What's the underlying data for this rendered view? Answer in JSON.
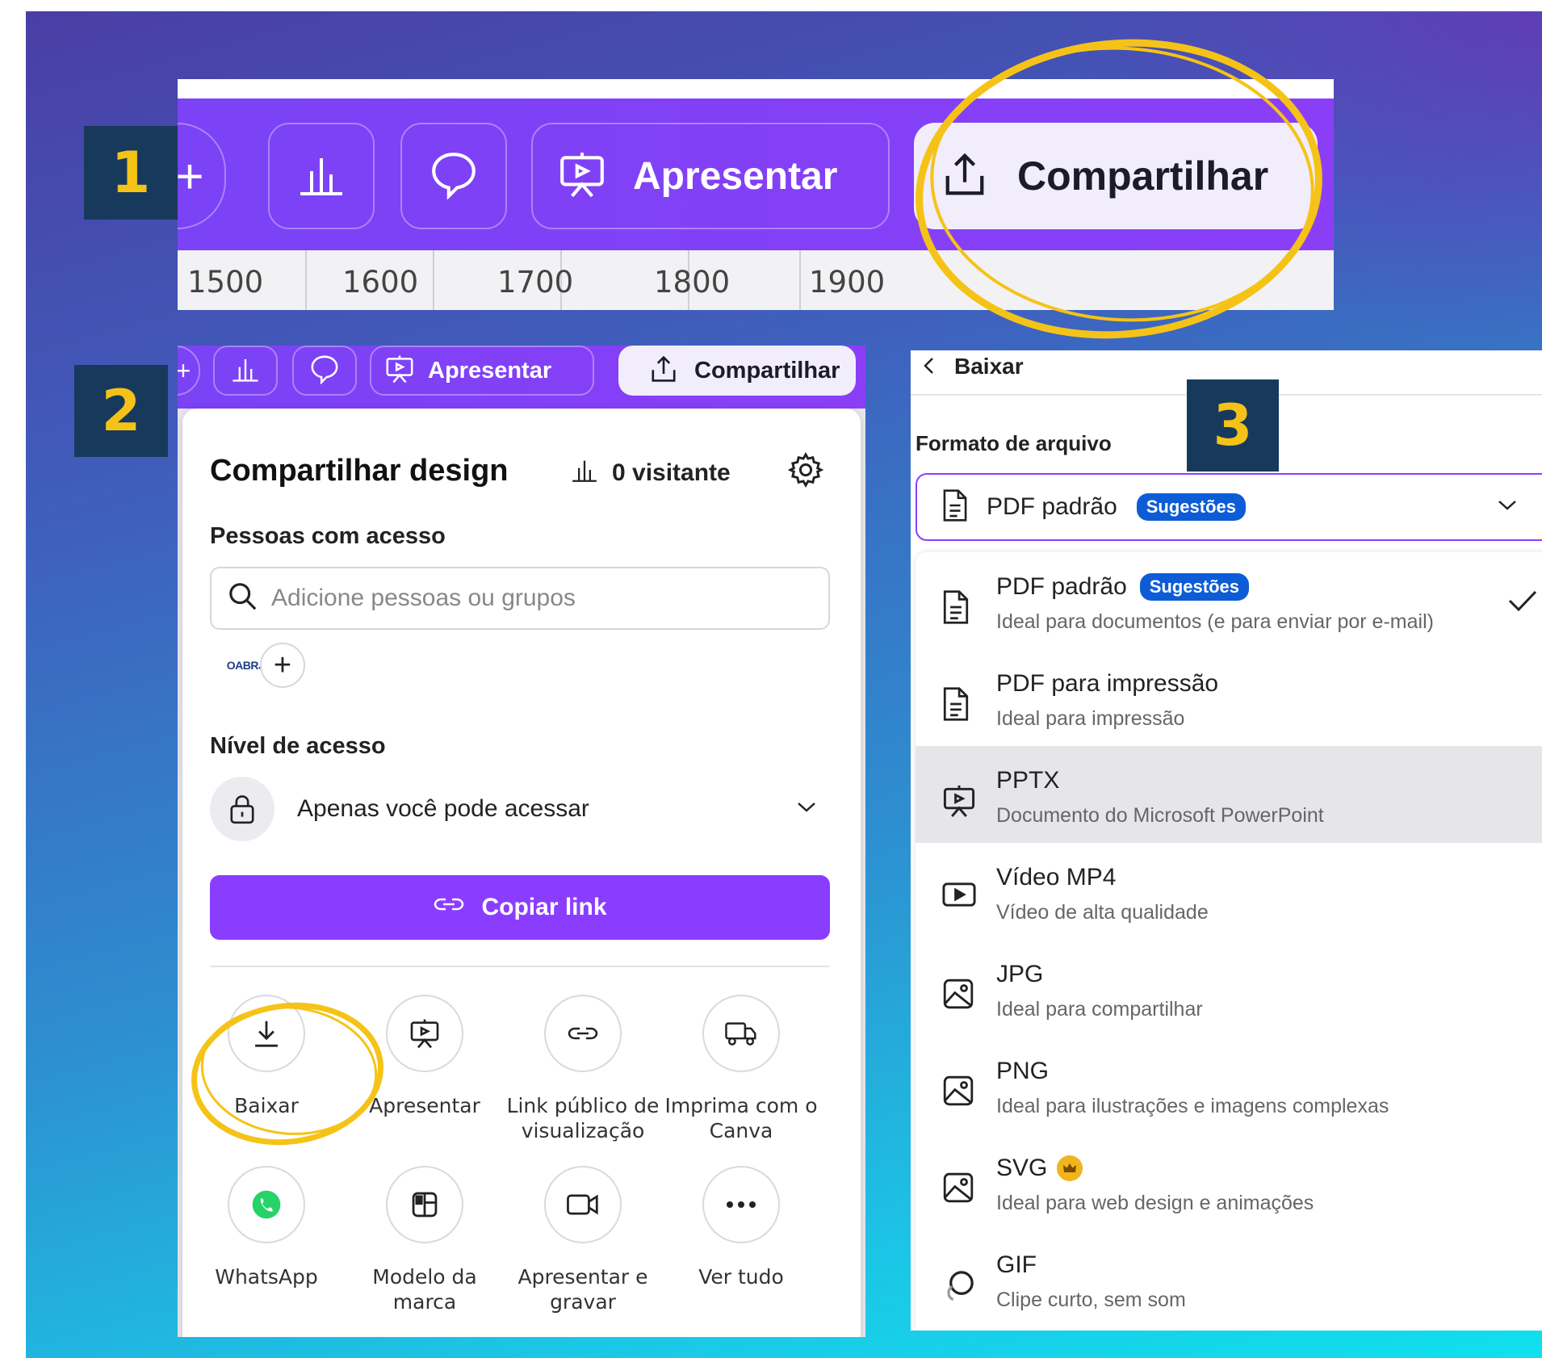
{
  "steps": [
    "1",
    "2",
    "3"
  ],
  "toolbar_large": {
    "plus_label": "+",
    "present_label": "Apresentar",
    "share_label": "Compartilhar",
    "ruler": [
      "1500",
      "1600",
      "1700",
      "1800",
      "1900"
    ]
  },
  "toolbar_small": {
    "plus_label": "+",
    "present_label": "Apresentar",
    "share_label": "Compartilhar"
  },
  "share_panel": {
    "title": "Compartilhar design",
    "visitors": "0 visitante",
    "people_label": "Pessoas com acesso",
    "search_placeholder": "Adicione pessoas ou grupos",
    "avatar_text": "OABRJ",
    "add_person": "+",
    "access_label": "Nível de acesso",
    "access_value": "Apenas você pode acessar",
    "copy_link": "Copiar link",
    "options": [
      {
        "label": "Baixar",
        "icon": "download-icon"
      },
      {
        "label": "Apresentar",
        "icon": "presentation-icon"
      },
      {
        "label": "Link público de visualização",
        "icon": "link-icon"
      },
      {
        "label": "Imprima com o Canva",
        "icon": "truck-icon"
      },
      {
        "label": "WhatsApp",
        "icon": "whatsapp-icon"
      },
      {
        "label": "Modelo da marca",
        "icon": "brand-template-icon"
      },
      {
        "label": "Apresentar e gravar",
        "icon": "video-camera-icon"
      },
      {
        "label": "Ver tudo",
        "icon": "more-icon"
      }
    ]
  },
  "download_panel": {
    "back_label": "Baixar",
    "format_label": "Formato de arquivo",
    "selected_format": "PDF padrão",
    "suggestion_badge": "Sugestões",
    "formats": [
      {
        "name": "PDF padrão",
        "desc": "Ideal para documentos (e para enviar por e-mail)",
        "badge": "Sugestões",
        "checked": true
      },
      {
        "name": "PDF para impressão",
        "desc": "Ideal para impressão"
      },
      {
        "name": "PPTX",
        "desc": "Documento do Microsoft PowerPoint",
        "highlighted": true
      },
      {
        "name": "Vídeo MP4",
        "desc": "Vídeo de alta qualidade"
      },
      {
        "name": "JPG",
        "desc": "Ideal para compartilhar"
      },
      {
        "name": "PNG",
        "desc": "Ideal para ilustrações e imagens complexas"
      },
      {
        "name": "SVG",
        "desc": "Ideal para web design e animações",
        "premium": true
      },
      {
        "name": "GIF",
        "desc": "Clipe curto, sem som"
      }
    ]
  },
  "colors": {
    "accent_purple": "#8b3dff",
    "badge_bg": "#173a5c",
    "badge_text": "#f5c318",
    "highlight_ring": "#f5c318",
    "suggestion_blue": "#0d5cd6"
  }
}
